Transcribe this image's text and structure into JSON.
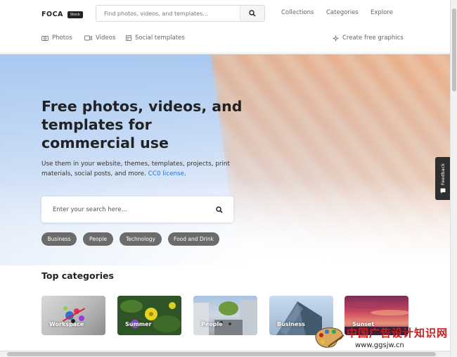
{
  "header": {
    "logo_text": "FOCA",
    "logo_badge": "Stock",
    "search_placeholder": "Find photos, videos, and templates...",
    "nav": [
      "Collections",
      "Categories",
      "Explore"
    ],
    "subnav": {
      "photos": "Photos",
      "videos": "Videos",
      "social": "Social templates",
      "create": "Create free graphics"
    }
  },
  "hero": {
    "title": "Free photos, videos, and templates for commercial use",
    "description": "Use them in your website, themes, templates, projects, print materials, social posts, and more.",
    "link_text": "CC0 license",
    "trailing": ".",
    "search_placeholder": "Enter your search here...",
    "tags": [
      "Business",
      "People",
      "Technology",
      "Food and Drink"
    ]
  },
  "categories": {
    "title": "Top categories",
    "items": [
      "Workspace",
      "Summer",
      "People",
      "Business",
      "Sunset"
    ]
  },
  "feedback_label": "Feedback",
  "watermark": {
    "cn": "中国广告设计知识网",
    "url": "www.ggsjw.cn"
  },
  "colors": {
    "link": "#1f74c7",
    "tag_bg": "#6b6b6b",
    "feedback_bg": "#2f2f2f",
    "watermark_red": "#c81e1e"
  }
}
